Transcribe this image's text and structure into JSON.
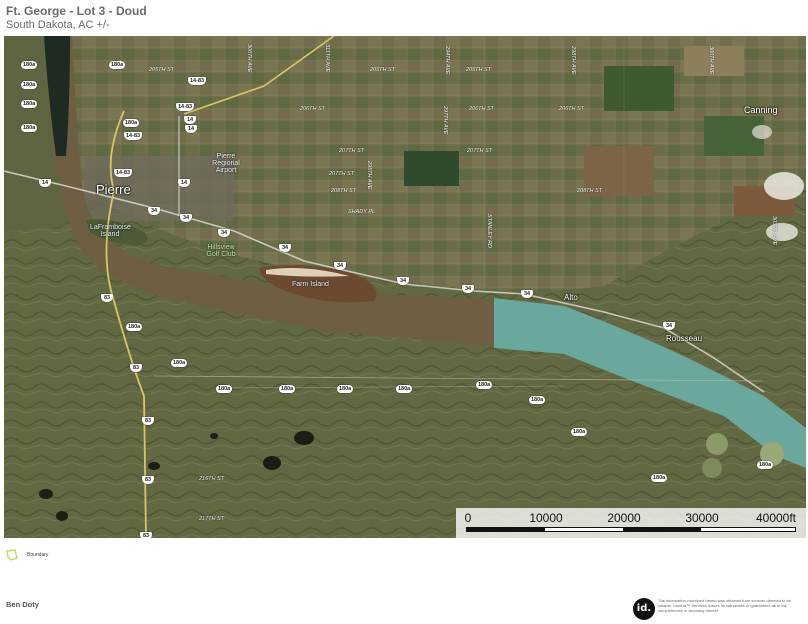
{
  "header": {
    "title": "Ft. George - Lot 3 - Doud",
    "subtitle": "South Dakota,  AC +/-"
  },
  "map": {
    "towns": {
      "pierre": "Pierre",
      "canning": "Canning",
      "rousseau": "Rousseau",
      "alto": "Alto"
    },
    "features": {
      "laframboise": "LaFramboise Island",
      "farm_island": "Farm Island",
      "airport": "Pierre Regional Airport",
      "golf": "Hillsview Golf Club",
      "shady": "SHADY PL"
    },
    "roads": {
      "st205a": "205TH ST",
      "st205b": "205TH ST",
      "st205c": "205TH ST",
      "st206a": "206TH ST",
      "st206b": "206TH ST",
      "st206c": "206TH ST",
      "st207a": "207TH ST",
      "st207b": "207TH ST",
      "st207c": "207TH ST",
      "st208": "208TH ST",
      "st208b": "208TH ST",
      "st216": "216TH ST",
      "st217": "217TH ST",
      "ave294": "294TH AVE",
      "ave295": "295TH AVE",
      "ave297": "297TH AVE",
      "ave298": "298TH AVE",
      "ave300": "300TH AVE",
      "ave303": "303RD AVE",
      "ave306": "306TH AVE",
      "ave311": "311TH AVE",
      "stanley": "STANLEY RD"
    },
    "shields": {
      "s180a": "180a",
      "s180b": "180a",
      "s180c": "180a",
      "s180d": "180a",
      "s180e": "180a",
      "s180f": "180a",
      "s180g": "180a",
      "s180h": "180a",
      "s180i": "180a",
      "s180j": "180a",
      "s180k": "180a",
      "s180l": "180a",
      "s180m": "180a",
      "s180n": "180a",
      "s180o": "180a",
      "s180p": "180a",
      "s180q": "180a",
      "s1483a": "14-83",
      "s1483b": "14-83",
      "s1483c": "14-83",
      "s1483d": "14-83",
      "s14a": "14",
      "s14b": "14",
      "s14c": "14",
      "s14d": "14",
      "s34a": "34",
      "s34b": "34",
      "s34c": "34",
      "s34d": "34",
      "s34e": "34",
      "s34f": "34",
      "s34g": "34",
      "s34h": "34",
      "s34i": "34",
      "s83a": "83",
      "s83b": "83",
      "s83c": "83",
      "s83d": "83",
      "s83e": "83"
    },
    "scale": {
      "ticks": [
        "0",
        "10000",
        "20000",
        "30000",
        "40000ft"
      ]
    }
  },
  "legend": {
    "boundary_label": "Boundary",
    "boundary_color": "#c9d45a"
  },
  "footer": {
    "author": "Ben Doty",
    "logo": "id.",
    "disclaimer": "The information contained herein was obtained from sources deemed to be reliable. Land id™ Services makes no warranties or guarantees as to the completeness or accuracy thereof."
  },
  "colors": {
    "river": "#6e5f43",
    "lake": "#6aa79c",
    "terrain": "#5d6541",
    "farmland": "#7a7450"
  }
}
